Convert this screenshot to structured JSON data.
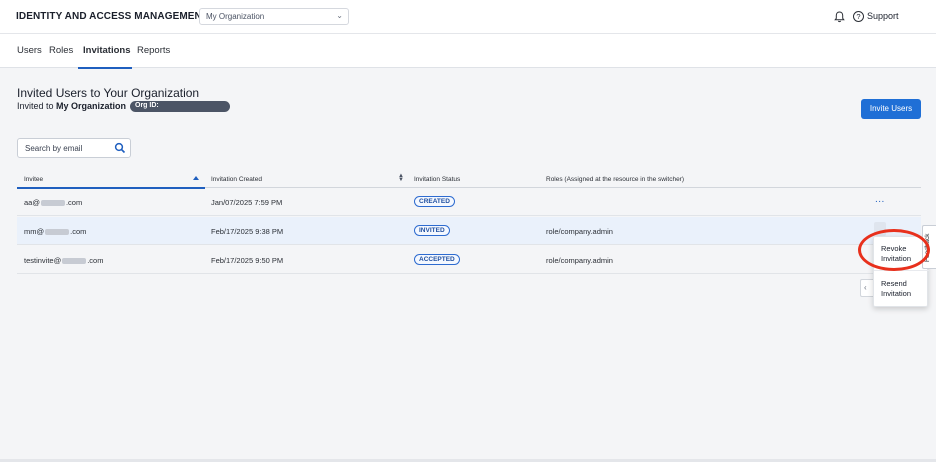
{
  "header": {
    "app_title": "IDENTITY AND ACCESS MANAGEMENT",
    "org_selector_value": "My Organization",
    "support_label": "Support"
  },
  "tabs": [
    {
      "label": "Users",
      "active": false
    },
    {
      "label": "Roles",
      "active": false
    },
    {
      "label": "Invitations",
      "active": true
    },
    {
      "label": "Reports",
      "active": false
    }
  ],
  "page": {
    "title": "Invited Users to Your Organization",
    "invited_to_prefix": "Invited to",
    "invited_to_org": "My Organization",
    "org_id_label": "Org ID:",
    "invite_button": "Invite Users",
    "search_placeholder": "Search by email"
  },
  "table": {
    "columns": [
      "Invitee",
      "Invitation Created",
      "Invitation Status",
      "Roles (Assigned at the resource in the switcher)"
    ],
    "rows": [
      {
        "invitee_prefix": "aa@",
        "invitee_suffix": ".com",
        "created": "Jan/07/2025 7:59 PM",
        "status": "CREATED",
        "roles": ""
      },
      {
        "invitee_prefix": "mm@",
        "invitee_suffix": ".com",
        "created": "Feb/17/2025 9:38 PM",
        "status": "INVITED",
        "roles": "role/company.admin"
      },
      {
        "invitee_prefix": "testinvite@",
        "invitee_suffix": ".com",
        "created": "Feb/17/2025 9:50 PM",
        "status": "ACCEPTED",
        "roles": "role/company.admin"
      }
    ],
    "row_actions_label": "..."
  },
  "context_menu": {
    "items": [
      "Revoke Invitation",
      "Resend Invitation"
    ]
  },
  "feedback_tab": "Feedback",
  "colors": {
    "accent": "#1f6fd6",
    "highlight_ring": "#e8301c"
  }
}
